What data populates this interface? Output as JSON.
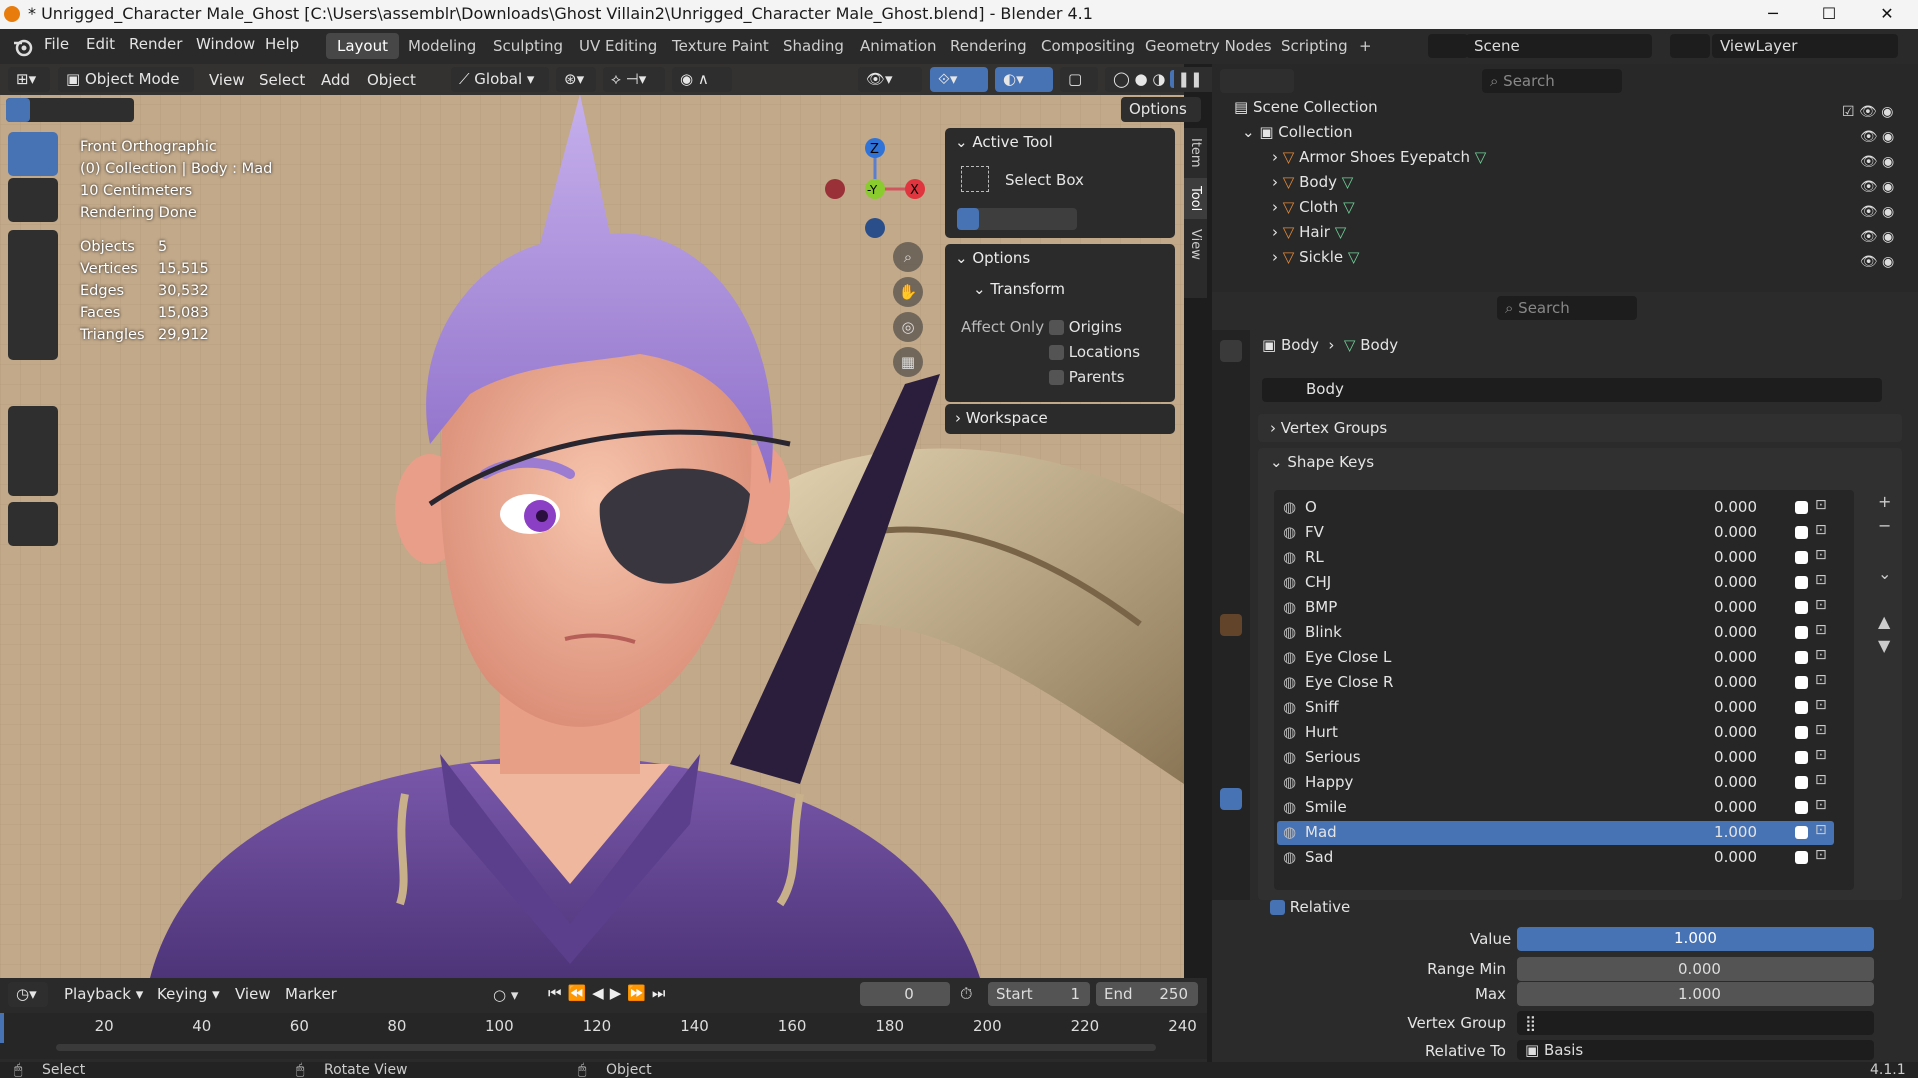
{
  "window": {
    "title": "* Unrigged_Character Male_Ghost [C:\\Users\\assemblr\\Downloads\\Ghost Villain2\\Unrigged_Character Male_Ghost.blend] - Blender 4.1",
    "min_label": "─",
    "max_label": "☐",
    "close_label": "✕"
  },
  "menubar": {
    "items": [
      "File",
      "Edit",
      "Render",
      "Window",
      "Help"
    ],
    "workspaces": [
      "Layout",
      "Modeling",
      "Sculpting",
      "UV Editing",
      "Texture Paint",
      "Shading",
      "Animation",
      "Rendering",
      "Compositing",
      "Geometry Nodes",
      "Scripting"
    ],
    "add_workspace": "+",
    "scene": "Scene",
    "view_layer": "ViewLayer"
  },
  "viewport": {
    "mode": "Object Mode",
    "menus": [
      "View",
      "Select",
      "Add",
      "Object"
    ],
    "orientation": "Global",
    "options_label": "Options",
    "overlay": {
      "view_name": "Front Orthographic",
      "collection": "(0) Collection | Body : Mad",
      "scale": "10 Centimeters",
      "status": "Rendering Done"
    },
    "stats": [
      {
        "label": "Objects",
        "value": "5"
      },
      {
        "label": "Vertices",
        "value": "15,515"
      },
      {
        "label": "Edges",
        "value": "30,532"
      },
      {
        "label": "Faces",
        "value": "15,083"
      },
      {
        "label": "Triangles",
        "value": "29,912"
      }
    ],
    "gizmo": {
      "z": "Z",
      "y": "-Y",
      "x": "X"
    }
  },
  "npanel": {
    "tabs": [
      "Item",
      "Tool",
      "View"
    ],
    "active_tool_header": "Active Tool",
    "active_tool": "Select Box",
    "options_header": "Options",
    "transform_header": "Transform",
    "affect_only": "Affect Only",
    "checks": [
      {
        "label": "Origins",
        "checked": false
      },
      {
        "label": "Locations",
        "checked": false
      },
      {
        "label": "Parents",
        "checked": false
      }
    ],
    "workspace_header": "Workspace"
  },
  "outliner": {
    "search_placeholder": "Search",
    "root": "Scene Collection",
    "collection": "Collection",
    "objects": [
      "Armor Shoes Eyepatch",
      "Body",
      "Cloth",
      "Hair",
      "Sickle"
    ]
  },
  "properties": {
    "search_placeholder": "Search",
    "breadcrumb_object": "Body",
    "breadcrumb_data": "Body",
    "mesh_name": "Body",
    "vertex_groups": "Vertex Groups",
    "shape_keys": "Shape Keys",
    "keys": [
      {
        "name": "O",
        "value": "0.000"
      },
      {
        "name": "FV",
        "value": "0.000"
      },
      {
        "name": "RL",
        "value": "0.000"
      },
      {
        "name": "CHJ",
        "value": "0.000"
      },
      {
        "name": "BMP",
        "value": "0.000"
      },
      {
        "name": "Blink",
        "value": "0.000"
      },
      {
        "name": "Eye Close L",
        "value": "0.000"
      },
      {
        "name": "Eye Close R",
        "value": "0.000"
      },
      {
        "name": "Sniff",
        "value": "0.000"
      },
      {
        "name": "Hurt",
        "value": "0.000"
      },
      {
        "name": "Serious",
        "value": "0.000"
      },
      {
        "name": "Happy",
        "value": "0.000"
      },
      {
        "name": "Smile",
        "value": "0.000"
      },
      {
        "name": "Mad",
        "value": "1.000",
        "selected": true
      },
      {
        "name": "Sad",
        "value": "0.000"
      }
    ],
    "relative_label": "Relative",
    "value_label": "Value",
    "value": "1.000",
    "value_fraction": 1.0,
    "range_min_label": "Range Min",
    "range_min": "0.000",
    "max_label": "Max",
    "max": "1.000",
    "vertex_group_label": "Vertex Group",
    "relative_to_label": "Relative To",
    "relative_to": "Basis"
  },
  "timeline": {
    "menus": [
      "Playback",
      "Keying",
      "View",
      "Marker"
    ],
    "current_frame": "0",
    "start_label": "Start",
    "start": "1",
    "end_label": "End",
    "end": "250",
    "ticks": [
      "20",
      "40",
      "60",
      "80",
      "100",
      "120",
      "140",
      "160",
      "180",
      "200",
      "220",
      "240"
    ]
  },
  "statusbar": {
    "select": "Select",
    "rotate": "Rotate View",
    "object": "Object",
    "version": "4.1.1"
  },
  "colors": {
    "accent": "#4772b3",
    "hair": "#a98bd9",
    "skin": "#f2b59b",
    "outfit": "#6b4a9c",
    "grid_bg": "#c2a98a"
  }
}
